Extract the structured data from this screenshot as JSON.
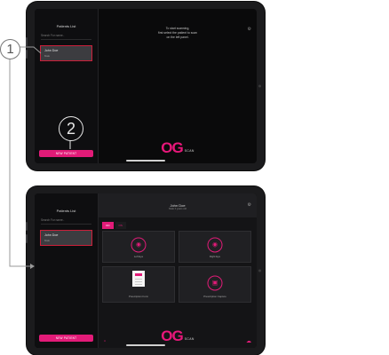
{
  "screen1": {
    "sidebar_title": "Patients List",
    "search_placeholder": "Search For name..",
    "patient_name": "John Doe",
    "patient_sub": "Male",
    "new_patient_label": "NEW PATIENT",
    "hint_line1": "To start scanning,",
    "hint_line2": "first select the patient to scan",
    "hint_line3": "on the left panel."
  },
  "screen2": {
    "sidebar_title": "Patients List",
    "search_placeholder": "Search For name..",
    "patient_name": "John Doe",
    "patient_sub": "Male",
    "new_patient_label": "NEW PATIENT",
    "header_name": "John Doe",
    "header_sub": "Male 0 years old",
    "tabs": [
      {
        "label": "OD"
      },
      {
        "label": "OS"
      }
    ],
    "tiles": [
      {
        "label": "Left Eye"
      },
      {
        "label": "Right Eye"
      },
      {
        "label": "Prescription Form"
      },
      {
        "label": "Prescription Capture"
      }
    ]
  },
  "logo": {
    "og": "OG",
    "scan": "SCAN"
  },
  "callouts": [
    "1",
    "2"
  ],
  "icons": {
    "settings": "gear-icon",
    "eye": "eye-scan-icon",
    "camera": "camera-icon",
    "folder": "folder-icon",
    "cloud": "cloud-icon"
  },
  "colors": {
    "accent": "#e21b78",
    "background": "#0a0a0b",
    "selection_border": "#cc1f3a"
  }
}
